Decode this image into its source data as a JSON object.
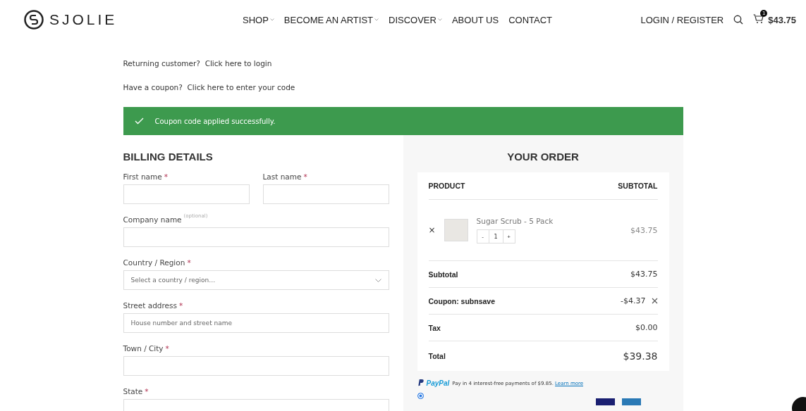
{
  "header": {
    "logo": "SJOLIE",
    "nav": [
      {
        "label": "SHOP",
        "dropdown": true
      },
      {
        "label": "BECOME AN ARTIST",
        "dropdown": true
      },
      {
        "label": "DISCOVER",
        "dropdown": true
      },
      {
        "label": "ABOUT US",
        "dropdown": false
      },
      {
        "label": "CONTACT",
        "dropdown": false
      }
    ],
    "login": "LOGIN / REGISTER",
    "cart_count": "1",
    "cart_total": "$43.75"
  },
  "notices": [
    {
      "text": "Returning customer?",
      "link": "Click here to login"
    },
    {
      "text": "Have a coupon?",
      "link": "Click here to enter your code"
    }
  ],
  "success_message": "Coupon code applied successfully.",
  "billing": {
    "title": "BILLING DETAILS",
    "fields": [
      {
        "label": "First name",
        "required_mark": "*",
        "kind": "input",
        "half": true
      },
      {
        "label": "Last name",
        "required_mark": "*",
        "kind": "input",
        "half": true
      },
      {
        "label": "Company name",
        "optional": "(optional)",
        "kind": "input",
        "half": false
      },
      {
        "label": "Country / Region",
        "required_mark": "*",
        "kind": "select",
        "placeholder": "Select a country / region…",
        "half": false
      },
      {
        "label": "Street address",
        "required_mark": "*",
        "kind": "input",
        "placeholder": "House number and street name",
        "half": false
      },
      {
        "label": "Town / City",
        "required_mark": "*",
        "kind": "input",
        "half": false
      },
      {
        "label": "State",
        "required_mark": "*",
        "kind": "input",
        "half": false
      }
    ]
  },
  "order": {
    "title": "YOUR ORDER",
    "columns": [
      "PRODUCT",
      "SUBTOTAL"
    ],
    "items": [
      {
        "name": "Sugar Scrub - 5 Pack",
        "quantity": "1",
        "minus": "-",
        "plus": "+",
        "remove": "×",
        "price": "$43.75"
      }
    ],
    "totals": [
      {
        "label": "Subtotal",
        "value": "$43.75",
        "kind": "plain"
      },
      {
        "label": "Coupon: subnsave",
        "value": "-$4.37",
        "kind": "coupon"
      },
      {
        "label": "Tax",
        "value": "$0.00",
        "kind": "plain"
      },
      {
        "label": "Total",
        "value": "$39.38",
        "kind": "total"
      }
    ],
    "paypal": {
      "brand": "PayPal",
      "text": "Pay in 4 interest-free payments of $9.85.",
      "link": "Learn more"
    },
    "payment_selected": true
  }
}
